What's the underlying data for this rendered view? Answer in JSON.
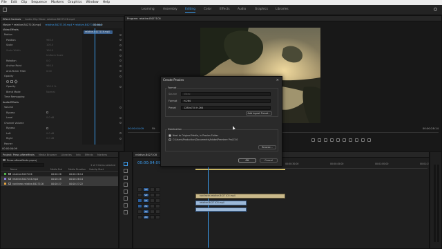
{
  "menubar": {
    "items": [
      "File",
      "Edit",
      "Clip",
      "Sequence",
      "Markers",
      "Graphics",
      "Window",
      "Help"
    ]
  },
  "workspaces": {
    "tabs": [
      "Learning",
      "Assembly",
      "Editing",
      "Color",
      "Effects",
      "Audio",
      "Graphics",
      "Libraries"
    ],
    "active": "Editing"
  },
  "effect_controls": {
    "tabs": [
      "Effect Controls",
      "Audio Clip Mixer: relative-B4271C6.mp4",
      "Program Monitor"
    ],
    "clip_title": "Master * relative-B4271C6.mp4",
    "clip_path": "relative-B4271C6.mp4 * relative-B4271C6.mp4",
    "timecode": "00:00:0",
    "clip_chip": "relative-B4271C6.mp4",
    "sections": {
      "video_effects": "Video Effects",
      "motion": "Motion",
      "opacity": "Opacity",
      "time_remapping": "Time Remapping",
      "audio_effects": "Audio Effects",
      "volume": "Volume",
      "channel_volume": "Channel Volume",
      "panner": "Panner"
    },
    "motion_props": [
      {
        "label": "Position",
        "value": "960.0"
      },
      {
        "label": "Scale",
        "value": "100.0"
      },
      {
        "label": "Scale Width",
        "value": "100.0"
      },
      {
        "label": "",
        "value": "Uniform Scale"
      },
      {
        "label": "Rotation",
        "value": "0.0"
      },
      {
        "label": "Anchor Point",
        "value": "960.0"
      },
      {
        "label": "Anti-flicker Filter",
        "value": "0.00"
      }
    ],
    "opacity_props": [
      {
        "label": "Opacity",
        "value": "100.0 %"
      },
      {
        "label": "Blend Mode",
        "value": "Normal"
      }
    ],
    "volume_props": [
      {
        "label": "Bypass",
        "value": ""
      },
      {
        "label": "Level",
        "value": "0.0 dB"
      }
    ],
    "channel_props": [
      {
        "label": "Bypass",
        "value": ""
      },
      {
        "label": "Left",
        "value": "0.0 dB"
      },
      {
        "label": "Right",
        "value": "0.0 dB"
      }
    ],
    "footer_timecode": "00:00:04:09"
  },
  "program_monitor": {
    "tab": "Program: relative-B4271C6",
    "timecode_left": "00:00:04:09",
    "fit": "Fit",
    "timecode_right": "00:00:28:14"
  },
  "project": {
    "tabs": [
      "Project: Press aftereffects",
      "Media Browser",
      "Libraries",
      "Info",
      "Effects",
      "Markers"
    ],
    "name": "Press aftereffects.prproj",
    "count": "2 of 3 items selected",
    "columns": [
      "Name",
      "Media End",
      "Media Duration",
      "Subclip Start"
    ],
    "rows": [
      {
        "name": "relative-B4271C6",
        "c1": "00:00:28",
        "c2": "00:00:28:14",
        "selected": false,
        "color": "#4fb04a"
      },
      {
        "name": "relative-B4271C6.mp4",
        "c1": "00:00:28",
        "c2": "00:00:28:14",
        "selected": true,
        "color": "#8a7bd9"
      },
      {
        "name": "nonlinear-relative-B4271C6",
        "c1": "00:00:27",
        "c2": "00:00:27:22",
        "selected": true,
        "color": "#e0a040"
      }
    ]
  },
  "timeline": {
    "tab": "relative-B4271C6",
    "timecode": "00:00:04:09",
    "ruler": [
      "00:00",
      "00:00:15:00",
      "00:00:30:00",
      "00:00:45:00",
      "00:01:00:00",
      "00:01:15:00"
    ],
    "tracks": [
      "V3",
      "V2",
      "V1",
      "A1",
      "A2",
      "A3"
    ],
    "source_patch": [
      "V1",
      "A1"
    ],
    "clips": {
      "v2": "nonlinear-relative-B4271C6.mp4",
      "v1": "relative-B4271C6.mp4",
      "a1": ""
    }
  },
  "dialog": {
    "title": "Create Proxies",
    "format_group": "Format",
    "source_label": "Source",
    "source_value": "Video",
    "format_label": "Format",
    "format_value": "H.264",
    "preset_label": "Preset",
    "preset_value": "1280x720 H.264",
    "add_ingest_label": "Add Ingest Preset...",
    "destination_group": "Destination",
    "dest_option1": "Next to Original Media, in Proxies Folder",
    "dest_option2": "C:\\Users\\Production\\Documents\\Adobe\\Premiere Pro\\13.0",
    "browse_label": "Browse...",
    "ok_label": "OK",
    "cancel_label": "Cancel"
  },
  "colors": {
    "accent": "#3b9df0",
    "clip_video": "#9bb8d8",
    "clip_v2": "#c9b98a",
    "playhead": "#3b9df0"
  }
}
